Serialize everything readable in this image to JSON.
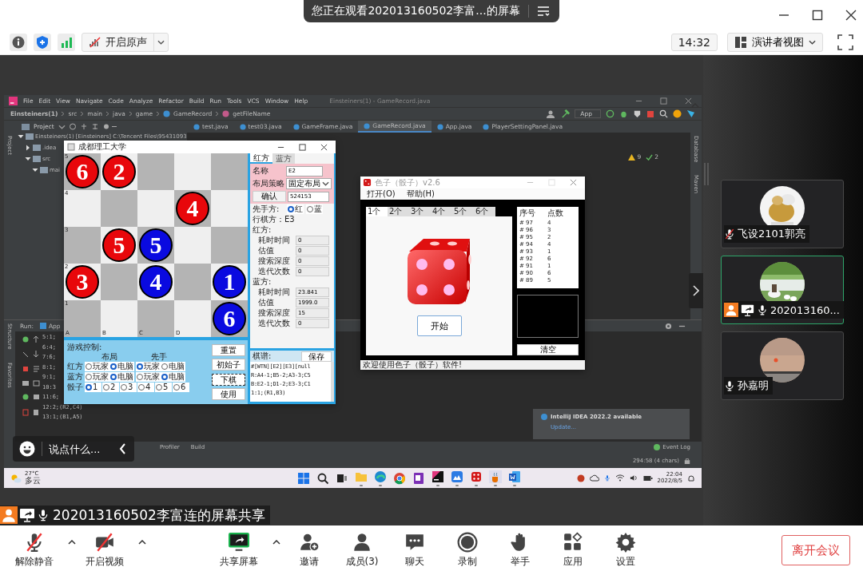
{
  "meeting_banner": {
    "text": "您正在观看202013160502李富...的屏幕"
  },
  "toolbar": {
    "sound_button": "开启原声",
    "time": "14:32",
    "view_button": "演讲者视图"
  },
  "shared_screen": {
    "ide": {
      "menu": [
        "File",
        "Edit",
        "View",
        "Navigate",
        "Code",
        "Analyze",
        "Refactor",
        "Build",
        "Run",
        "Tools",
        "VCS",
        "Window",
        "Help"
      ],
      "title": "Einsteiners(1) - GameRecord.java",
      "breadcrumb": [
        {
          "label": "Einsteiners(1)",
          "kind": "project"
        },
        {
          "label": "src",
          "kind": "folder"
        },
        {
          "label": "main",
          "kind": "folder"
        },
        {
          "label": "java",
          "kind": "folder"
        },
        {
          "label": "game",
          "kind": "folder"
        },
        {
          "label": "GameRecord",
          "kind": "class"
        },
        {
          "label": "getFileName",
          "kind": "method"
        }
      ],
      "run_config": "App",
      "project_label": "Project",
      "side_labels": [
        "Project"
      ],
      "right_labels": [
        "Database",
        "Maven"
      ],
      "tabs": [
        {
          "label": "test.java",
          "selected": false
        },
        {
          "label": "test03.java",
          "selected": false
        },
        {
          "label": "GameFrame.java",
          "selected": false
        },
        {
          "label": "GameRecord.java",
          "selected": true
        },
        {
          "label": "App.java",
          "selected": false
        },
        {
          "label": "PlayerSettingPanel.java",
          "selected": false
        }
      ],
      "project_tree": [
        {
          "label": "Einsteiners(1) [Einsteiners] C:\\Tencent Files\\95431093",
          "expanded": true,
          "children": [
            {
              "label": ".idea",
              "expanded": false
            },
            {
              "label": "src",
              "expanded": true,
              "children": [
                {
                  "label": "mai",
                  "expanded": true
                }
              ]
            }
          ]
        }
      ],
      "warnings": "9",
      "checks": "2",
      "run_label": "Run:",
      "run_tab": "App",
      "run_side_labels": [
        "Structure",
        "Favorites"
      ],
      "console_lines": [
        "5:1;",
        "6:4;",
        "7:6;",
        "8:1;",
        "9:1;",
        "10:3",
        "11:6;",
        "12:2;(R2,C4)",
        "13:1;(B1,A5)"
      ],
      "bottom_tabs": [
        "Profiler",
        "Build"
      ],
      "event_log": "Event Log",
      "cursor_position": "294:58 (4 chars)",
      "notification": {
        "title": "IntelliJ IDEA 2022.2 available",
        "link": "Update..."
      }
    },
    "game_window": {
      "title": "成都理工大学",
      "board": {
        "rows": [
          [
            {
              "piece": "6",
              "color": "#e8070b"
            },
            {
              "piece": "2",
              "color": "#e8070b"
            },
            {},
            {},
            {}
          ],
          [
            {},
            {},
            {},
            {
              "piece": "4",
              "color": "#e8070b"
            },
            {}
          ],
          [
            {},
            {
              "piece": "5",
              "color": "#e8070b"
            },
            {
              "piece": "5",
              "color": "#0a0ae0"
            },
            {},
            {}
          ],
          [
            {
              "piece": "3",
              "color": "#e8070b"
            },
            {},
            {
              "piece": "4",
              "color": "#0a0ae0"
            },
            {},
            {
              "piece": "1",
              "color": "#0a0ae0"
            }
          ],
          [
            {},
            {},
            {},
            {},
            {
              "piece": "6",
              "color": "#0a0ae0"
            }
          ]
        ],
        "row_labels": [
          "5",
          "4",
          "3",
          "2",
          "1"
        ],
        "column_labels": [
          "A",
          "B",
          "C",
          "D"
        ]
      },
      "player_tabs": [
        {
          "label": "红方",
          "selected": true
        },
        {
          "label": "蓝方",
          "selected": false
        }
      ],
      "name_label": "名称",
      "name_value": "E2",
      "layout_label": "布局策略",
      "layout_value": "固定布局",
      "confirm_button": "确认",
      "layout_code": "524153",
      "first_label": "先手方:",
      "first_options": [
        {
          "label": "红",
          "selected": true
        },
        {
          "label": "蓝",
          "selected": false
        }
      ],
      "turn": "行棋方：E3",
      "stats": [
        {
          "title": "红方:",
          "rows": [
            {
              "label": "耗时时间",
              "value": "0"
            },
            {
              "label": "估值",
              "value": "0"
            },
            {
              "label": "搜索深度",
              "value": "0"
            },
            {
              "label": "迭代次数",
              "value": "0"
            }
          ]
        },
        {
          "title": "蓝方:",
          "rows": [
            {
              "label": "耗时时间",
              "value": "23.841"
            },
            {
              "label": "估值",
              "value": "1999.0"
            },
            {
              "label": "搜索深度",
              "value": "15"
            },
            {
              "label": "迭代次数",
              "value": "0"
            }
          ]
        }
      ],
      "controls": {
        "title": "游戏控制:",
        "headers": [
          "布局",
          "先手"
        ],
        "rows": [
          {
            "label": "红方",
            "options": [
              {
                "label": "玩家",
                "selected": false
              },
              {
                "label": "电脑",
                "selected": true
              },
              {
                "label": "玩家",
                "selected": true
              },
              {
                "label": "电脑",
                "selected": false
              }
            ]
          },
          {
            "label": "蓝方",
            "options": [
              {
                "label": "玩家",
                "selected": false
              },
              {
                "label": "电脑",
                "selected": true
              },
              {
                "label": "玩家",
                "selected": false
              },
              {
                "label": "电脑",
                "selected": true
              }
            ]
          }
        ],
        "dice_label": "骰子",
        "dice_options": [
          {
            "label": "1",
            "selected": true
          },
          {
            "label": "2",
            "selected": false
          },
          {
            "label": "3",
            "selected": false
          },
          {
            "label": "4",
            "selected": false
          },
          {
            "label": "5",
            "selected": false
          },
          {
            "label": "6",
            "selected": false
          }
        ]
      },
      "buttons": [
        {
          "label": "重置",
          "focused": false
        },
        {
          "label": "初始子",
          "focused": false
        },
        {
          "label": "下棋",
          "focused": true
        },
        {
          "label": "使用",
          "focused": false
        }
      ],
      "record": {
        "label": "棋谱:",
        "save_button": "保存",
        "lines": [
          "#[WTN][E2][E3][null",
          "R:A4-1;B5-2;A3-3;C5",
          "B:E2-1;D1-2;E3-3;C1",
          "1:1;(R1,B3)"
        ]
      }
    },
    "dice_window": {
      "title": "色子（骰子）v2.6",
      "menu": [
        "打开(O)",
        "帮助(H)"
      ],
      "tabs": [
        {
          "label": "1个",
          "selected": true
        },
        {
          "label": "2个",
          "selected": false
        },
        {
          "label": "3个",
          "selected": false
        },
        {
          "label": "4个",
          "selected": false
        },
        {
          "label": "5个",
          "selected": false
        },
        {
          "label": "6个",
          "selected": false
        }
      ],
      "start_button": "开始",
      "table": {
        "columns": [
          "序号",
          "点数"
        ],
        "rows": [
          [
            "# 97",
            "4"
          ],
          [
            "# 96",
            "3"
          ],
          [
            "# 95",
            "2"
          ],
          [
            "# 94",
            "4"
          ],
          [
            "# 93",
            "1"
          ],
          [
            "# 92",
            "6"
          ],
          [
            "# 91",
            "1"
          ],
          [
            "# 90",
            "6"
          ],
          [
            "# 89",
            "5"
          ]
        ]
      },
      "clear_button": "清空",
      "status": "欢迎使用色子（骰子）软件!"
    },
    "taskbar": {
      "temperature": "27°C",
      "weather": "多云",
      "apps": [
        {
          "kind": "start",
          "running": false
        },
        {
          "kind": "search",
          "running": false
        },
        {
          "kind": "taskview",
          "running": false
        },
        {
          "kind": "folder",
          "running": true
        },
        {
          "kind": "swirl",
          "running": true
        },
        {
          "kind": "globe",
          "running": false
        },
        {
          "kind": "notebook",
          "running": false
        },
        {
          "kind": "ide",
          "running": true
        },
        {
          "kind": "mountain",
          "running": true
        },
        {
          "kind": "dice",
          "running": true
        },
        {
          "kind": "cup",
          "running": true
        },
        {
          "kind": "document",
          "running": true
        }
      ],
      "time": "22:04",
      "date": "2022/8/5"
    }
  },
  "presenter": {
    "label": "202013160502李富连的屏幕共享",
    "host": true,
    "sharing": true,
    "muted": false
  },
  "chat": {
    "placeholder": "说点什么..."
  },
  "participants": [
    {
      "name": "飞设2101郭亮",
      "muted": true,
      "host": false,
      "sharing": false,
      "selected": false
    },
    {
      "name": "202013160...",
      "muted": false,
      "host": true,
      "sharing": true,
      "selected": true
    },
    {
      "name": "孙嘉明",
      "muted": false,
      "host": false,
      "sharing": false,
      "selected": false
    }
  ],
  "controls": [
    {
      "label": "解除静音",
      "kind": "mic_muted",
      "menu": true
    },
    {
      "label": "开启视频",
      "kind": "video_off",
      "menu": true
    },
    {
      "label": "共享屏幕",
      "kind": "share",
      "menu": true
    },
    {
      "label": "邀请",
      "kind": "invite",
      "menu": false
    },
    {
      "label": "成员(3)",
      "kind": "members",
      "menu": false
    },
    {
      "label": "聊天",
      "kind": "chat",
      "menu": false
    },
    {
      "label": "录制",
      "kind": "record",
      "menu": false
    },
    {
      "label": "举手",
      "kind": "hand",
      "menu": false
    },
    {
      "label": "应用",
      "kind": "apps",
      "menu": false
    },
    {
      "label": "设置",
      "kind": "settings",
      "menu": false
    }
  ],
  "leave_button": "离开会议"
}
